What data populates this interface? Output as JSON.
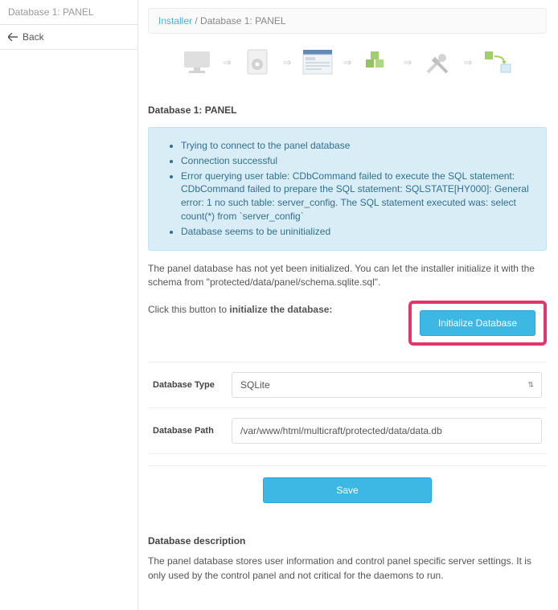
{
  "sidebar": {
    "title": "Database 1: PANEL",
    "back_label": "Back"
  },
  "breadcrumb": {
    "link": "Installer",
    "separator": " / ",
    "current": "Database 1: PANEL"
  },
  "steps": {
    "icons": [
      "monitor-icon",
      "gear-document-icon",
      "window-icon",
      "cubes-icon",
      "tools-icon",
      "transfer-cubes-icon"
    ]
  },
  "heading": "Database 1: PANEL",
  "flash": {
    "items": [
      "Trying to connect to the panel database",
      "Connection successful",
      "Error querying user table: CDbCommand failed to execute the SQL statement: CDbCommand failed to prepare the SQL statement: SQLSTATE[HY000]: General error: 1 no such table: server_config. The SQL statement executed was: select count(*) from `server_config`",
      "Database seems to be uninitialized"
    ]
  },
  "paragraph1": "The panel database has not yet been initialized. You can let the installer initialize it with the schema from \"protected/data/panel/schema.sqlite.sql\".",
  "init_prompt_pre": "Click this button to ",
  "init_prompt_bold": "initialize the database:",
  "init_button": "Initialize Database",
  "form": {
    "db_type_label": "Database Type",
    "db_type_value": "SQLite",
    "db_path_label": "Database Path",
    "db_path_value": "/var/www/html/multicraft/protected/data/data.db",
    "save_label": "Save"
  },
  "desc_heading": "Database description",
  "desc_text": "The panel database stores user information and control panel specific server settings. It is only used by the control panel and not critical for the daemons to run."
}
